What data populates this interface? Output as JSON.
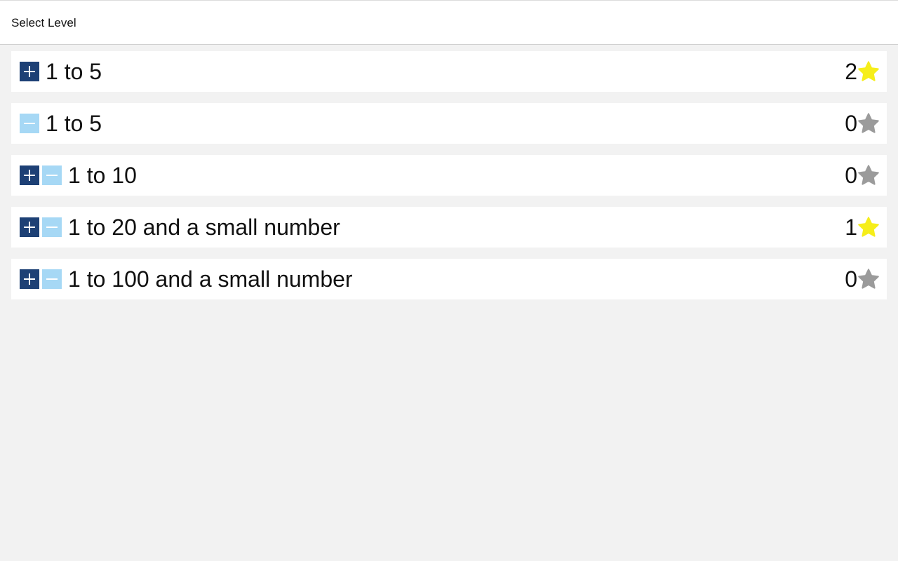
{
  "header": {
    "title": "Select Level"
  },
  "colors": {
    "plus_bg": "#1d4075",
    "minus_bg": "#a6d8f5",
    "star_earned": "#f6ee1a",
    "star_empty": "#9b9b9b"
  },
  "levels": [
    {
      "label": "1 to 5",
      "operations": [
        "plus"
      ],
      "stars": "2",
      "star_state": "earned"
    },
    {
      "label": "1 to 5",
      "operations": [
        "minus"
      ],
      "stars": "0",
      "star_state": "empty"
    },
    {
      "label": "1 to 10",
      "operations": [
        "plus",
        "minus"
      ],
      "stars": "0",
      "star_state": "empty"
    },
    {
      "label": "1 to 20 and a small number",
      "operations": [
        "plus",
        "minus"
      ],
      "stars": "1",
      "star_state": "earned"
    },
    {
      "label": "1 to 100 and a small number",
      "operations": [
        "plus",
        "minus"
      ],
      "stars": "0",
      "star_state": "empty"
    }
  ],
  "icons": {
    "plus": "plus-icon",
    "minus": "minus-icon",
    "star": "star-icon"
  }
}
